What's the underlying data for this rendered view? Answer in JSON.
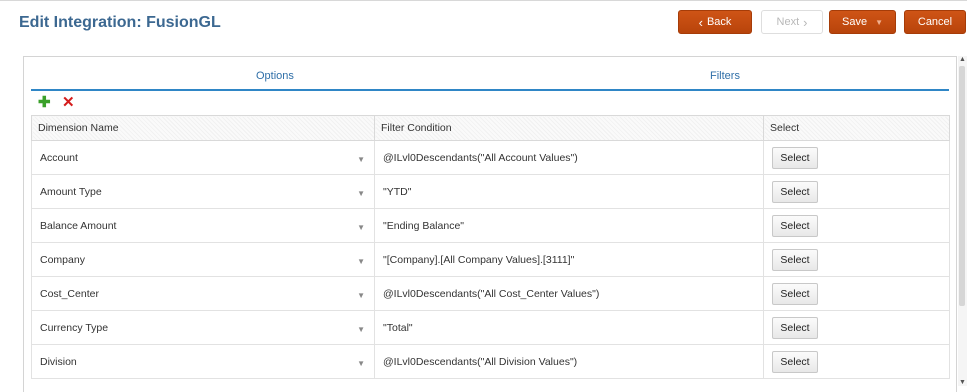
{
  "page": {
    "title": "Edit Integration: FusionGL"
  },
  "toolbar": {
    "back_label": "Back",
    "next_label": "Next",
    "save_label": "Save",
    "cancel_label": "Cancel"
  },
  "tabs": [
    {
      "label": "Options"
    },
    {
      "label": "Filters",
      "active": true
    }
  ],
  "grid": {
    "headers": [
      "Dimension Name",
      "Filter Condition",
      "Select"
    ],
    "rows": [
      {
        "dimension": "Account",
        "filter": "@ILvl0Descendants(\"All Account Values\")",
        "select": "Select"
      },
      {
        "dimension": "Amount Type",
        "filter": "\"YTD\"",
        "select": "Select"
      },
      {
        "dimension": "Balance Amount",
        "filter": "\"Ending Balance\"",
        "select": "Select"
      },
      {
        "dimension": "Company",
        "filter": "\"[Company].[All Company Values].[3111]\"",
        "select": "Select"
      },
      {
        "dimension": "Cost_Center",
        "filter": "@ILvl0Descendants(\"All Cost_Center Values\")",
        "select": "Select"
      },
      {
        "dimension": "Currency Type",
        "filter": "\"Total\"",
        "select": "Select"
      },
      {
        "dimension": "Division",
        "filter": "@ILvl0Descendants(\"All Division Values\")",
        "select": "Select"
      }
    ]
  },
  "icons": {
    "back": "chevron-left-icon",
    "next": "chevron-right-icon",
    "save_menu": "caret-down-icon",
    "add": "plus-icon",
    "delete": "x-icon",
    "dropdown": "caret-down-icon"
  },
  "colors": {
    "title": "#3c6891",
    "primary_button": "#c24a0c",
    "tab_underline": "#2f86c6",
    "add_icon": "#3aa02a",
    "delete_icon": "#d41c1c"
  }
}
